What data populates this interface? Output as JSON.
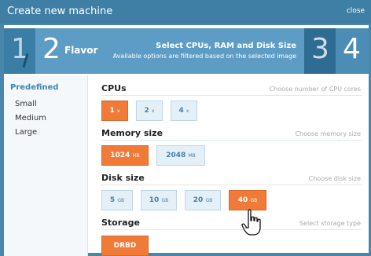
{
  "window": {
    "title": "Create new machine",
    "close_label": "close"
  },
  "steps": [
    {
      "number": "1"
    },
    {
      "number": "2",
      "name": "Flavor",
      "heading": "Select CPUs, RAM and Disk Size",
      "subheading": "Available options are filtered based on the selected image"
    },
    {
      "number": "3"
    },
    {
      "number": "4"
    }
  ],
  "sidebar": {
    "heading": "Predefined",
    "items": [
      "Small",
      "Medium",
      "Large"
    ]
  },
  "sections": {
    "cpus": {
      "title": "CPUs",
      "hint": "Choose number of CPU cores",
      "options": [
        {
          "value": "1",
          "unit": "x",
          "selected": true
        },
        {
          "value": "2",
          "unit": "x"
        },
        {
          "value": "4",
          "unit": "x"
        }
      ]
    },
    "memory": {
      "title": "Memory size",
      "hint": "Choose memory size",
      "options": [
        {
          "value": "1024",
          "unit": "MB",
          "selected": true
        },
        {
          "value": "2048",
          "unit": "MB"
        }
      ]
    },
    "disk": {
      "title": "Disk size",
      "hint": "Choose disk size",
      "options": [
        {
          "value": "5",
          "unit": "GB"
        },
        {
          "value": "10",
          "unit": "GB"
        },
        {
          "value": "20",
          "unit": "GB"
        },
        {
          "value": "40",
          "unit": "GB",
          "selected": true
        }
      ]
    },
    "storage": {
      "title": "Storage",
      "hint": "Select storage type",
      "options": [
        {
          "value": "DRBD",
          "selected": true
        }
      ]
    }
  },
  "colors": {
    "accent": "#f07a38",
    "primary": "#3f7fa6",
    "option": "#e4f0f8"
  },
  "icons": {
    "cursor": "hand-pointer-icon"
  }
}
